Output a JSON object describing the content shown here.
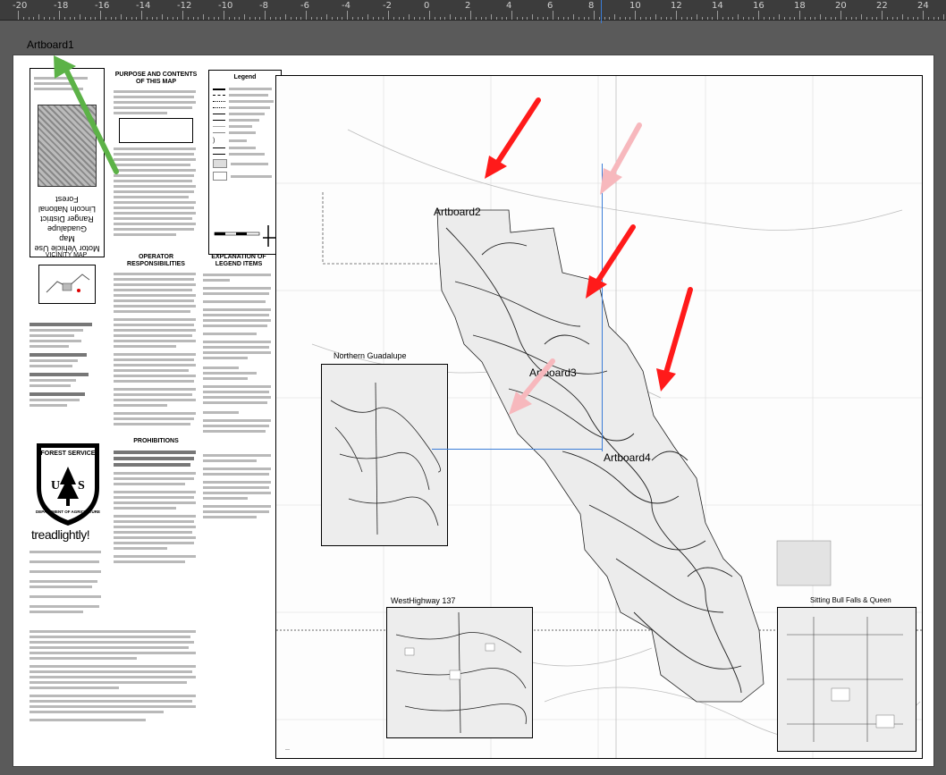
{
  "ruler": {
    "labels": [
      "-20",
      "-18",
      "-16",
      "-14",
      "-12",
      "-10",
      "-8",
      "-6",
      "-4",
      "-2",
      "0",
      "2",
      "4",
      "6",
      "8",
      "10",
      "12",
      "14",
      "16",
      "18",
      "20",
      "22",
      "24"
    ]
  },
  "artboards": {
    "artboard1": "Artboard1",
    "artboard2": "Artboard2",
    "artboard3": "Artboard3",
    "artboard4": "Artboard4"
  },
  "panel": {
    "purpose_title": "PURPOSE AND CONTENTS OF THIS MAP",
    "vicinity_title": "VICINITY MAP",
    "operator_title": "OPERATOR RESPONSIBILITIES",
    "explanation_title": "EXPLANATION OF LEGEND ITEMS",
    "prohibitions_title": "PROHIBITIONS",
    "legend_title": "Legend",
    "cover_title_1": "Motor Vehicle Use",
    "cover_title_2": "Map",
    "cover_title_3": "Guadalupe",
    "cover_title_4": "Ranger District",
    "cover_title_5": "Lincoln National Forest",
    "shield_top": "FOREST SERVICE",
    "shield_mid": "U S",
    "shield_bottom": "DEPARTMENT OF AGRICULTURE",
    "tread_text": "treadlightly!"
  },
  "insets": {
    "northern": "Northern Guadalupe",
    "west": "WestHighway 137",
    "sitting": "Sitting Bull Falls & Queen"
  },
  "colors": {
    "arrow_red": "#ff1a1a",
    "arrow_pink": "#f7b8bd",
    "arrow_green": "#5cb247",
    "guide_blue": "#3b7dd8"
  }
}
